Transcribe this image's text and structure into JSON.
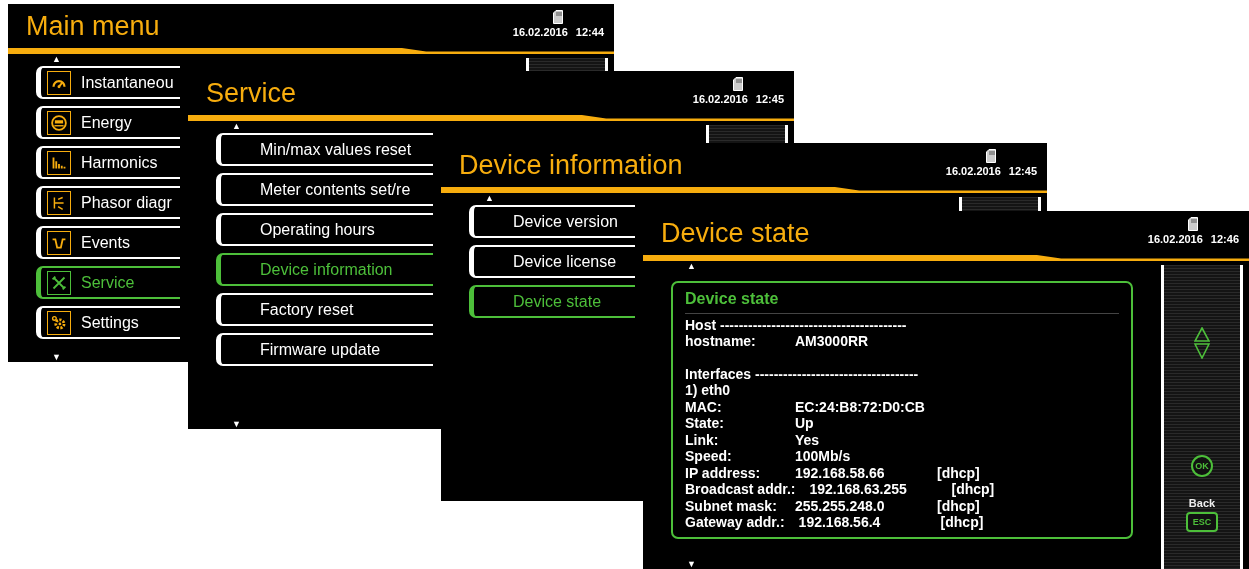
{
  "windows": [
    {
      "kind": "menu",
      "title": "Main menu",
      "date": "16.02.2016",
      "time": "12:44",
      "scroll_up": "▲",
      "scroll_down": "▼",
      "items": [
        {
          "label": "Instantaneou",
          "selected": false
        },
        {
          "label": "Energy",
          "selected": false
        },
        {
          "label": "Harmonics",
          "selected": false
        },
        {
          "label": "Phasor diagr",
          "selected": false
        },
        {
          "label": "Events",
          "selected": false
        },
        {
          "label": "Service",
          "selected": true
        },
        {
          "label": "Settings",
          "selected": false
        }
      ]
    },
    {
      "kind": "menu",
      "title": "Service",
      "date": "16.02.2016",
      "time": "12:45",
      "scroll_up": "▲",
      "scroll_down": "▼",
      "items": [
        {
          "label": "Min/max values reset",
          "selected": false
        },
        {
          "label": "Meter contents set/re",
          "selected": false
        },
        {
          "label": "Operating hours",
          "selected": false
        },
        {
          "label": "Device information",
          "selected": true
        },
        {
          "label": "Factory reset",
          "selected": false
        },
        {
          "label": "Firmware update",
          "selected": false
        }
      ]
    },
    {
      "kind": "menu",
      "title": "Device information",
      "date": "16.02.2016",
      "time": "12:45",
      "scroll_up": "▲",
      "items": [
        {
          "label": "Device version",
          "selected": false
        },
        {
          "label": "Device license",
          "selected": false
        },
        {
          "label": "Device state",
          "selected": true
        }
      ]
    },
    {
      "kind": "info",
      "title": "Device state",
      "date": "16.02.2016",
      "time": "12:46",
      "scroll_up": "▲",
      "scroll_down": "▼",
      "panel": {
        "title": "Device state",
        "sections": [
          {
            "lines": [
              {
                "label": "Host ----------------------------------------"
              },
              {
                "label": "hostname:",
                "value": "AM3000RR"
              }
            ]
          },
          {
            "lines": [
              {
                "label": "Interfaces -----------------------------------"
              },
              {
                "label": "1) eth0"
              },
              {
                "label": "MAC:",
                "value": "EC:24:B8:72:D0:CB"
              },
              {
                "label": "State:",
                "value": "Up"
              },
              {
                "label": "Link:",
                "value": "Yes"
              },
              {
                "label": "Speed:",
                "value": "100Mb/s"
              },
              {
                "label": "IP address:",
                "value": "192.168.58.66",
                "tag": "[dhcp]"
              },
              {
                "label": "Broadcast addr.:",
                "value": "192.168.63.255",
                "tag": "[dhcp]"
              },
              {
                "label": "Subnet mask:",
                "value": "255.255.248.0",
                "tag": "[dhcp]"
              },
              {
                "label": "Gateway addr.:",
                "value": "192.168.56.4",
                "tag": "[dhcp]"
              }
            ]
          }
        ]
      },
      "side_panel": {
        "ok_label": "OK",
        "back_label": "Back",
        "esc_label": "ESC"
      }
    }
  ]
}
